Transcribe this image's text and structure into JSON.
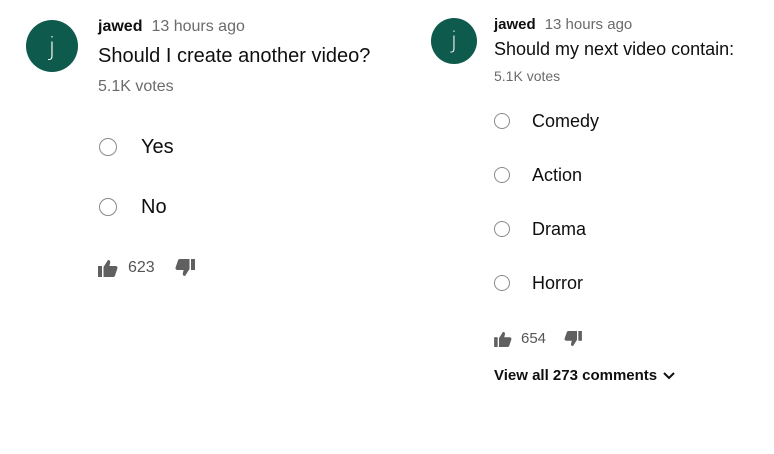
{
  "posts": [
    {
      "avatar_letter": "j",
      "author": "jawed",
      "time": "13 hours ago",
      "question": "Should I create another video?",
      "votes": "5.1K votes",
      "options": [
        "Yes",
        "No"
      ],
      "likes": "623"
    },
    {
      "avatar_letter": "j",
      "author": "jawed",
      "time": "13 hours ago",
      "question": "Should my next video contain:",
      "votes": "5.1K votes",
      "options": [
        "Comedy",
        "Action",
        "Drama",
        "Horror"
      ],
      "likes": "654",
      "view_comments": "View all 273 comments"
    }
  ],
  "icons": {
    "like": "thumbs-up-icon",
    "dislike": "thumbs-down-icon",
    "expand": "chevron-down-icon"
  },
  "colors": {
    "avatar_bg": "#0e5a4c",
    "secondary_text": "#6b6b6b"
  }
}
